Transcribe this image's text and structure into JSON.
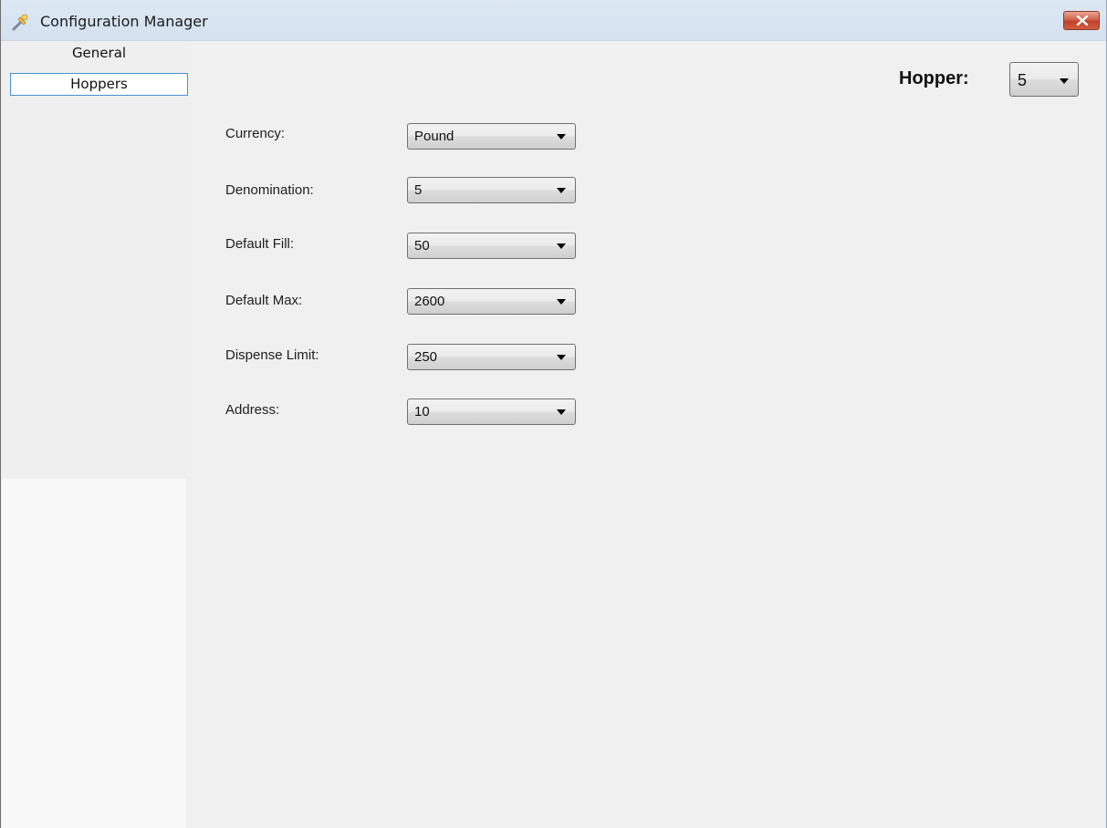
{
  "window": {
    "title": "Configuration Manager",
    "app_icon": "tools-icon",
    "close_icon": "close-icon",
    "close_color": "#c7432c"
  },
  "sidebar": {
    "items": [
      {
        "label": "General",
        "selected": false
      },
      {
        "label": "Hoppers",
        "selected": true
      }
    ],
    "selection_border_color": "#4b8fd6"
  },
  "hopper_selector": {
    "label": "Hopper:",
    "value": "5"
  },
  "fields": [
    {
      "label": "Currency:",
      "value": "Pound"
    },
    {
      "label": "Denomination:",
      "value": "5"
    },
    {
      "label": "Default Fill:",
      "value": "50"
    },
    {
      "label": "Default Max:",
      "value": "2600"
    },
    {
      "label": "Dispense Limit:",
      "value": "250"
    },
    {
      "label": "Address:",
      "value": "10"
    }
  ]
}
